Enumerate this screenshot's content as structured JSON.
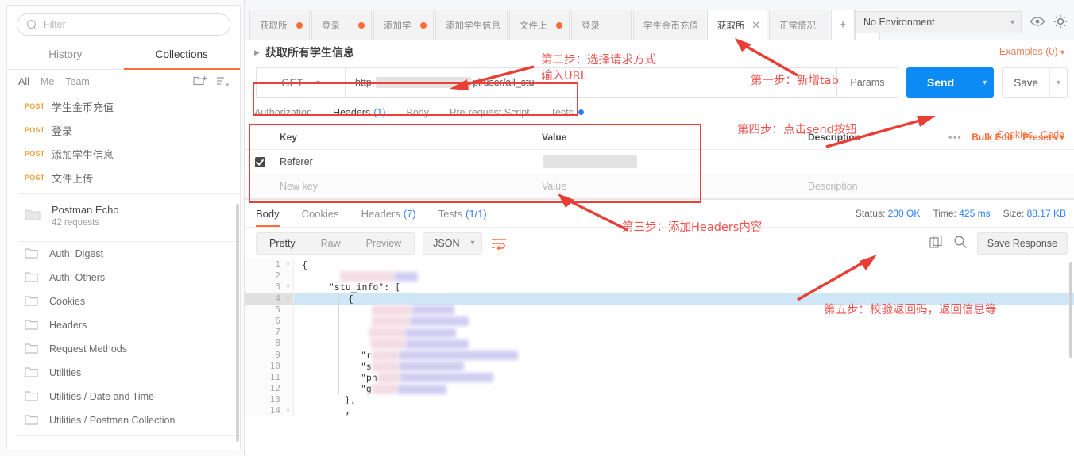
{
  "sidebar": {
    "search": {
      "placeholder": "Filter",
      "icon": "search-icon"
    },
    "tabs": [
      {
        "label": "History",
        "active": false
      },
      {
        "label": "Collections",
        "active": true
      }
    ],
    "scope_filters": [
      {
        "label": "All",
        "active": true
      },
      {
        "label": "Me",
        "active": false
      },
      {
        "label": "Team",
        "active": false
      }
    ],
    "new_folder_icon": "new-folder-icon",
    "sort_icon": "sort-icon",
    "requests": [
      {
        "method": "POST",
        "name": "学生金币充值"
      },
      {
        "method": "POST",
        "name": "登录"
      },
      {
        "method": "POST",
        "name": "添加学生信息"
      },
      {
        "method": "POST",
        "name": "文件上传"
      }
    ],
    "collection": {
      "title": "Postman Echo",
      "subtitle": "42 requests",
      "icon": "folder-icon"
    },
    "folders": [
      {
        "label": "Auth: Digest"
      },
      {
        "label": "Auth: Others"
      },
      {
        "label": "Cookies"
      },
      {
        "label": "Headers"
      },
      {
        "label": "Request Methods"
      },
      {
        "label": "Utilities"
      },
      {
        "label": "Utilities / Date and Time"
      },
      {
        "label": "Utilities / Postman Collection"
      }
    ]
  },
  "topbar": {
    "tabs": [
      {
        "label": "获取所",
        "dirty": true,
        "active": false
      },
      {
        "label": "登录",
        "dirty": true,
        "active": false
      },
      {
        "label": "添加学",
        "dirty": true,
        "active": false
      },
      {
        "label": "添加学生信息",
        "dirty": false,
        "active": false
      },
      {
        "label": "文件上",
        "dirty": true,
        "active": false
      },
      {
        "label": "登录",
        "dirty": false,
        "active": false
      },
      {
        "label": "学生金币充值",
        "dirty": false,
        "active": false
      },
      {
        "label": "获取所",
        "dirty": false,
        "active": true
      },
      {
        "label": "正常情况",
        "dirty": false,
        "active": false
      }
    ],
    "new_tab_label": "+",
    "more_label": "•••",
    "environment": {
      "value": "No Environment",
      "caret": "chevron-down-icon"
    },
    "eye_icon": "eye-icon",
    "gear_icon": "gear-icon"
  },
  "request": {
    "name": "获取所有学生信息",
    "examples_label": "Examples (0)",
    "method": "GET",
    "url_prefix": "http:",
    "url_suffix": "pi/user/all_stu",
    "params_label": "Params",
    "send_label": "Send",
    "save_label": "Save",
    "cookies_link": "Cookies",
    "code_link": "Code",
    "tabs": [
      {
        "label": "Authorization",
        "count": "",
        "active": false
      },
      {
        "label": "Headers",
        "count": "(1)",
        "active": true
      },
      {
        "label": "Body",
        "count": "",
        "active": false
      },
      {
        "label": "Pre-request Script",
        "count": "",
        "active": false
      },
      {
        "label": "Tests",
        "count": "",
        "active": false,
        "dot": true
      }
    ],
    "headers_table": {
      "columns": {
        "key": "Key",
        "value": "Value",
        "description": "Description"
      },
      "tools": {
        "dots": "•••",
        "bulk_edit": "Bulk Edit",
        "presets": "Presets ▾"
      },
      "rows": [
        {
          "checked": true,
          "key": "Referer",
          "value": "",
          "description": ""
        }
      ],
      "new_row": {
        "key": "New key",
        "value": "Value",
        "description": "Description"
      }
    }
  },
  "response": {
    "tabs": [
      {
        "label": "Body",
        "count": "",
        "active": true
      },
      {
        "label": "Cookies",
        "count": "",
        "active": false
      },
      {
        "label": "Headers",
        "count": "(7)",
        "active": false
      },
      {
        "label": "Tests",
        "count": "(1/1)",
        "active": false
      }
    ],
    "status": {
      "label": "Status:",
      "value": "200 OK"
    },
    "time": {
      "label": "Time:",
      "value": "425 ms"
    },
    "size": {
      "label": "Size:",
      "value": "88.17 KB"
    },
    "view_modes": [
      {
        "label": "Pretty",
        "active": true
      },
      {
        "label": "Raw",
        "active": false
      },
      {
        "label": "Preview",
        "active": false
      }
    ],
    "format": "JSON",
    "wrap_icon": "word-wrap-icon",
    "copy_icon": "copy-icon",
    "search_icon": "search-icon",
    "save_response_label": "Save Response",
    "body_lines": [
      {
        "no": "1",
        "fold": true,
        "text": "{",
        "redacted": false
      },
      {
        "no": "2",
        "fold": false,
        "text": "",
        "redacted": true
      },
      {
        "no": "3",
        "fold": true,
        "text": "\"stu_info\": [",
        "redacted": false
      },
      {
        "no": "4",
        "fold": true,
        "text": "{",
        "redacted": false,
        "highlight": true
      },
      {
        "no": "5",
        "fold": false,
        "text": "",
        "redacted": true
      },
      {
        "no": "6",
        "fold": false,
        "text": "",
        "redacted": true
      },
      {
        "no": "7",
        "fold": false,
        "text": "",
        "redacted": true
      },
      {
        "no": "8",
        "fold": false,
        "text": "",
        "redacted": true
      },
      {
        "no": "9",
        "fold": false,
        "text": "\"r",
        "redacted": true
      },
      {
        "no": "10",
        "fold": false,
        "text": "\"s",
        "redacted": true
      },
      {
        "no": "11",
        "fold": false,
        "text": "\"ph",
        "redacted": true
      },
      {
        "no": "12",
        "fold": false,
        "text": "\"g",
        "redacted": true
      },
      {
        "no": "13",
        "fold": false,
        "text": "},",
        "redacted": false
      },
      {
        "no": "14",
        "fold": true,
        "text": "",
        "redacted": false
      }
    ]
  },
  "annotations": [
    {
      "id": "step1",
      "text": "第一步：新增tab"
    },
    {
      "id": "step2a",
      "text": "第二步：选择请求方式"
    },
    {
      "id": "step2b",
      "text": "输入URL"
    },
    {
      "id": "step3",
      "text": "第三步：添加Headers内容"
    },
    {
      "id": "step4",
      "text": "第四步：点击send按钮"
    },
    {
      "id": "step5",
      "text": "第五步：校验返回码，返回信息等"
    }
  ],
  "colors": {
    "accent": "#ff6c37",
    "send": "#0d8bf4",
    "annotation": "#ef5350",
    "link": "#2d7ff9",
    "method_post": "#e8a33d"
  }
}
